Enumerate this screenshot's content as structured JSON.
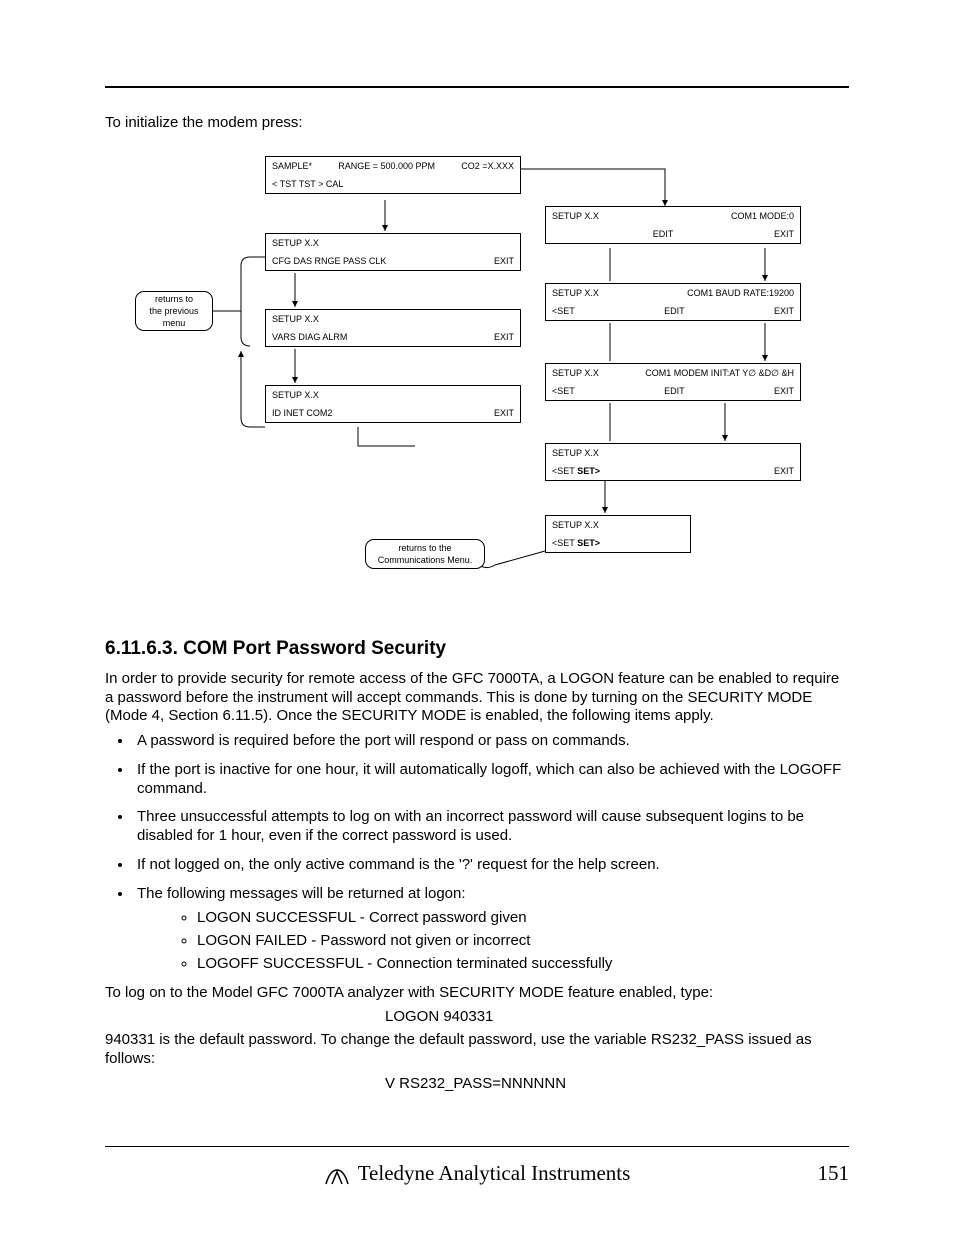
{
  "intro": "To initialize the modem press:",
  "diagram": {
    "leftNote": "returns to\nthe previous\nmenu",
    "commNote": "returns to the\nCommunications Menu.",
    "boxA": {
      "l1a": "SAMPLE*",
      "l1b": "RANGE = 500.000 PPM",
      "l1c": "CO2 =X.XXX",
      "l2a": "< TST  TST >  CAL"
    },
    "boxB": {
      "t": "SETUP X.X",
      "l": "CFG  DAS  RNGE  PASS  CLK",
      "r": "EXIT"
    },
    "boxC": {
      "t": "SETUP X.X",
      "l": "VARS  DIAG  ALRM",
      "r": "EXIT"
    },
    "boxD": {
      "t": "SETUP X.X",
      "l": "ID   INET            COM2",
      "r": "EXIT"
    },
    "boxE": {
      "t": "SETUP X.X",
      "tr": "COM1 MODE:0",
      "m": "EDIT",
      "r": "EXIT"
    },
    "boxF": {
      "t": "SETUP X.X",
      "tr": "COM1 BAUD RATE:19200",
      "l": "<SET",
      "m": "EDIT",
      "r": "EXIT"
    },
    "boxG": {
      "t": "SETUP X.X",
      "tr": "COM1 MODEM INIT:AT  Y∅ &D∅ &H",
      "l": "<SET",
      "m": "EDIT",
      "r": "EXIT"
    },
    "boxH": {
      "t": "SETUP X.X",
      "l": "<SET",
      "lb": "SET>",
      "r": "EXIT"
    },
    "boxI": {
      "t": "SETUP X.X",
      "l": "<SET",
      "lb": "SET>"
    }
  },
  "heading": "6.11.6.3. COM Port Password Security",
  "para1": "In order to provide security for remote access of the GFC 7000TA, a LOGON feature can be enabled to require a password before the instrument will accept commands.  This is done by turning on the SECURITY MODE (Mode 4, Section 6.11.5).  Once the SECURITY MODE is enabled, the following items apply.",
  "bullets": [
    "A password is required before the port will respond or pass on commands.",
    "If the port is inactive for one hour, it will automatically logoff, which can also be achieved with the LOGOFF command.",
    "Three unsuccessful attempts to log on with an incorrect password will cause subsequent logins to be disabled for 1 hour, even if the correct password is used.",
    "If not logged on, the only active command is the '?' request for the help screen.",
    "The following messages will be returned at logon:"
  ],
  "subbullets": [
    "LOGON SUCCESSFUL - Correct password given",
    "LOGON FAILED - Password not given or incorrect",
    "LOGOFF SUCCESSFUL - Connection terminated successfully"
  ],
  "para2": "To log on to the Model GFC 7000TA analyzer with SECURITY MODE feature enabled, type:",
  "logon": "LOGON 940331",
  "para3": "940331 is the default password.  To change the default password, use the variable RS232_PASS issued as follows:",
  "vcmd": "V RS232_PASS=NNNNNN",
  "footer": {
    "brand": "Teledyne Analytical Instruments",
    "page": "151"
  }
}
